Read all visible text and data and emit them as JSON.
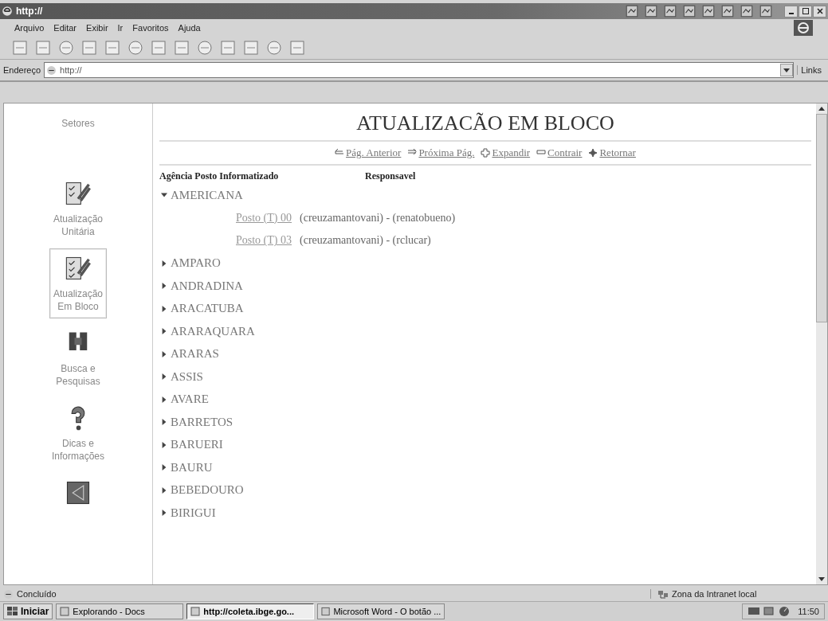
{
  "window": {
    "title": "http://"
  },
  "menu": [
    "Arquivo",
    "Editar",
    "Exibir",
    "Ir",
    "Favoritos",
    "Ajuda"
  ],
  "address": {
    "label": "Endereço",
    "value": "http://",
    "links": "Links"
  },
  "sidebar": {
    "title": "Setores",
    "items": [
      {
        "kind": "single",
        "label": "Atualização Unitária",
        "selected": false
      },
      {
        "kind": "bulk",
        "label": "Atualização Em Bloco",
        "selected": true
      },
      {
        "kind": "search",
        "label": "Busca e Pesquisas",
        "selected": false
      },
      {
        "kind": "help",
        "label": "Dicas e Informações",
        "selected": false
      },
      {
        "kind": "exit",
        "selected": false
      }
    ]
  },
  "page": {
    "title": "ATUALIZACÃO EM BLOCO",
    "nav": [
      {
        "kind": "prev",
        "label": "Pág. Anterior"
      },
      {
        "kind": "next",
        "label": "Próxima Pág."
      },
      {
        "kind": "expand",
        "label": "Expandir"
      },
      {
        "kind": "collapse",
        "label": "Contrair"
      },
      {
        "kind": "back",
        "label": "Retornar"
      }
    ],
    "columns": [
      "Agência Posto Informatizado",
      "Responsavel"
    ],
    "tree": [
      {
        "label": "AMERICANA",
        "expanded": true,
        "children": [
          {
            "label": "Posto (T) 00",
            "responsible": "(creuzamantovani) - (renatobueno)"
          },
          {
            "label": "Posto (T) 03",
            "responsible": "(creuzamantovani) - (rclucar)"
          }
        ]
      },
      {
        "label": "AMPARO",
        "expanded": false
      },
      {
        "label": "ANDRADINA",
        "expanded": false
      },
      {
        "label": "ARACATUBA",
        "expanded": false
      },
      {
        "label": "ARARAQUARA",
        "expanded": false
      },
      {
        "label": "ARARAS",
        "expanded": false
      },
      {
        "label": "ASSIS",
        "expanded": false
      },
      {
        "label": "AVARE",
        "expanded": false
      },
      {
        "label": "BARRETOS",
        "expanded": false
      },
      {
        "label": "BARUERI",
        "expanded": false
      },
      {
        "label": "BAURU",
        "expanded": false
      },
      {
        "label": "BEBEDOURO",
        "expanded": false
      },
      {
        "label": "BIRIGUI",
        "expanded": false
      }
    ]
  },
  "status": {
    "text": "Concluído",
    "zone": "Zona da Intranet local"
  },
  "taskbar": {
    "start": "Iniciar",
    "tasks": [
      {
        "label": "Explorando - Docs",
        "selected": false
      },
      {
        "label": "http://coleta.ibge.go...",
        "selected": true
      },
      {
        "label": "Microsoft Word - O botão ...",
        "selected": false
      }
    ],
    "clock": "11:50"
  }
}
